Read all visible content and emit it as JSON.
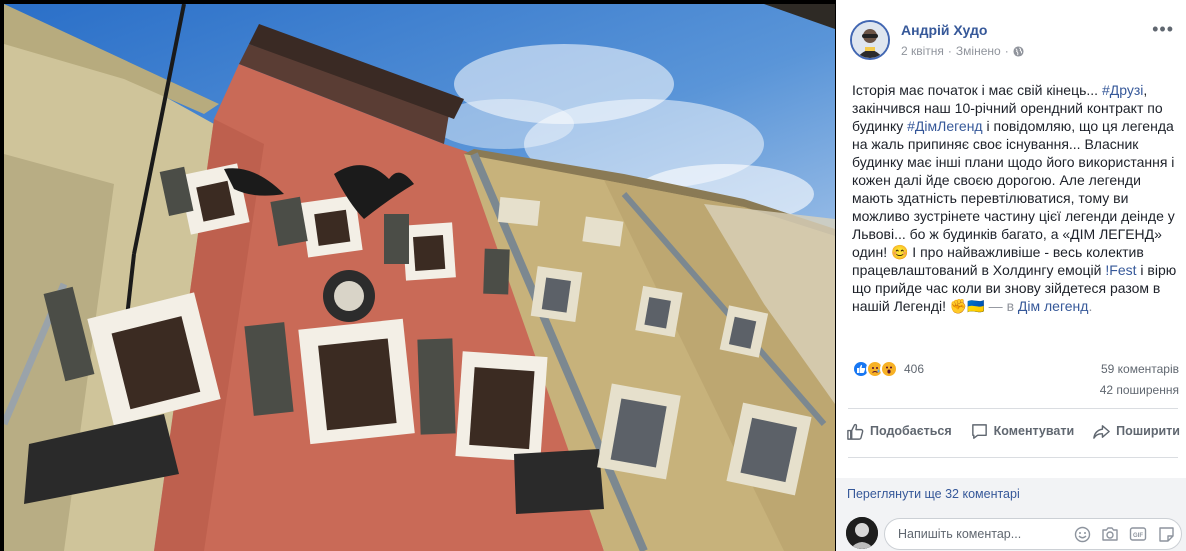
{
  "post": {
    "author": "Андрій Худо",
    "date": "2 квітня",
    "separator": "·",
    "edited": "Змінено",
    "separator2": "·",
    "text": {
      "p1": "Історія має початок і має свій кінець... ",
      "tag1": "#Друзі",
      "p2": ", закінчився наш 10-річний орендний контракт по будинку ",
      "tag2": "#ДімЛегенд",
      "p3": " і повідомляю, що ця легенда на жаль припиняє своє існування... Власник будинку має інші плани щодо його використання і кожен далі йде своєю дорогою. Але легенди мають здатність перевтілюватися, тому ви можливо зустрінете частину цієї легенди деінде у Львові... бо ж будинків багато, а «ДІМ ЛЕГЕНД» один! ",
      "emoji1": "😊",
      "p4": " І про найважливіше - весь колектив працевлаштований в Холдингу емоцій ",
      "tag3": "!Fest",
      "p5": " і вірю що прийде час коли ви знову зійдетеся разом в нашій Легенді! ",
      "emoji2": "✊",
      "emoji3": "🇺🇦",
      "with": " — в ",
      "place": "Дім легенд",
      "end": "."
    }
  },
  "stats": {
    "reaction_count": "406",
    "reactions": [
      "like",
      "sad",
      "wow"
    ],
    "comments": "59 коментарів",
    "shares": "42 поширення"
  },
  "actions": {
    "like": "Подобається",
    "comment": "Коментувати",
    "share": "Поширити"
  },
  "comments": {
    "view_more": "Переглянути ще 32 коментарі",
    "placeholder": "Напишіть коментар..."
  },
  "colors": {
    "link": "#365899",
    "like_blue": "#1877f2",
    "muted": "#90949c"
  }
}
